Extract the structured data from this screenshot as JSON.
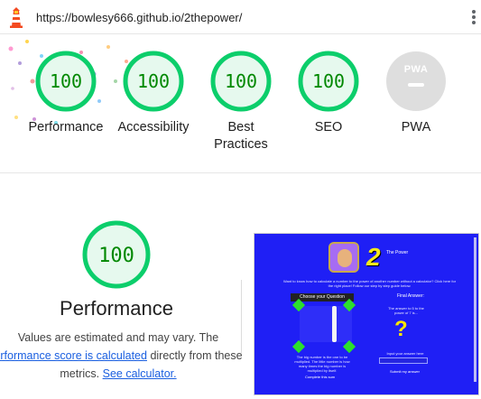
{
  "header": {
    "url": "https://bowlesy666.github.io/2thepower/",
    "logo_icon": "lighthouse-icon",
    "menu_icon": "kebab-menu-icon"
  },
  "gauges": [
    {
      "label": "Performance",
      "score": "100"
    },
    {
      "label": "Accessibility",
      "score": "100"
    },
    {
      "label": "Best Practices",
      "score": "100"
    },
    {
      "label": "SEO",
      "score": "100"
    }
  ],
  "pwa": {
    "badge_text": "PWA",
    "label": "PWA"
  },
  "performance": {
    "score": "100",
    "title": "Performance",
    "desc_line1": "Values are estimated and may vary. The",
    "desc_link": "erformance score is calculated",
    "desc_mid": "directly from these",
    "desc_line3_start": "metrics.",
    "calc_link": "See calculator."
  },
  "thumbnail": {
    "title_number": "2",
    "title_text": "The Power",
    "intro": "Want to know how to calculate a number to the power of another number without a calculator? Click here for the right place! Follow our step by step guide below.",
    "question_header": "Choose your Question",
    "final_header": "Final Answer:",
    "final_sub": "The answer to 5 to the power of 7 is...",
    "question_mark": "?",
    "panel_caption": "The big number is the one to be multiplied. The little number is how many times the big number is multiplied by itself.",
    "complete_btn": "Complete this sum",
    "input_caption": "Input your answer here",
    "submit_btn": "Submit my answer"
  },
  "colors": {
    "pass_green": "#0cce6b",
    "pass_text": "#008800",
    "pwa_grey": "#dedede",
    "link_blue": "#1a5fe0",
    "thumb_bg": "#1f1ff5"
  }
}
